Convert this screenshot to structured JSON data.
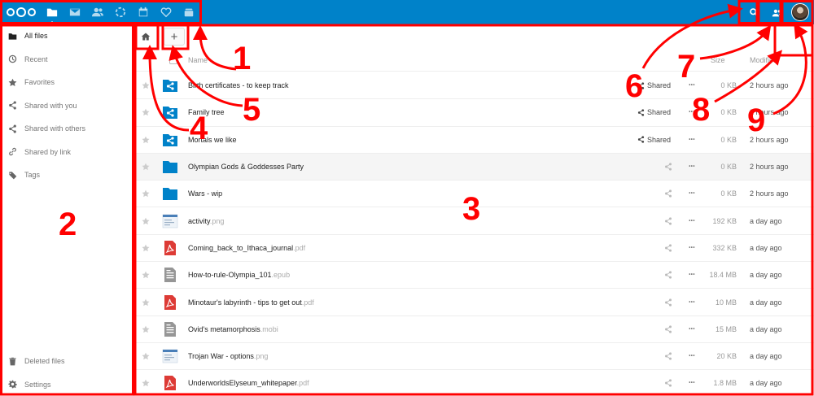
{
  "header": {
    "apps": [
      {
        "name": "files-app-icon",
        "active": true
      },
      {
        "name": "mail-app-icon",
        "active": false
      },
      {
        "name": "contacts-app-icon",
        "active": false
      },
      {
        "name": "activity-app-icon",
        "active": false
      },
      {
        "name": "calendar-app-icon",
        "active": false
      },
      {
        "name": "health-app-icon",
        "active": false
      },
      {
        "name": "deck-app-icon",
        "active": false
      }
    ]
  },
  "sidebar": {
    "items": [
      {
        "label": "All files",
        "icon": "folder-icon"
      },
      {
        "label": "Recent",
        "icon": "clock-icon"
      },
      {
        "label": "Favorites",
        "icon": "star-icon"
      },
      {
        "label": "Shared with you",
        "icon": "share-icon"
      },
      {
        "label": "Shared with others",
        "icon": "share-icon"
      },
      {
        "label": "Shared by link",
        "icon": "link-icon"
      },
      {
        "label": "Tags",
        "icon": "tag-icon"
      }
    ],
    "bottom": [
      {
        "label": "Deleted files",
        "icon": "trash-icon"
      },
      {
        "label": "Settings",
        "icon": "gear-icon"
      }
    ]
  },
  "controls": {
    "add_label": "+"
  },
  "table": {
    "col_name": "Name",
    "col_size": "Size",
    "col_modified": "Modified",
    "rows": [
      {
        "name": "Birth certificates - to keep track",
        "ext": "",
        "type": "shared-folder",
        "shared_label": "Shared",
        "size": "0 KB",
        "modified": "2 hours ago"
      },
      {
        "name": "Family tree",
        "ext": "",
        "type": "shared-folder",
        "shared_label": "Shared",
        "size": "0 KB",
        "modified": "2 hours ago"
      },
      {
        "name": "Mortals we like",
        "ext": "",
        "type": "shared-folder",
        "shared_label": "Shared",
        "size": "0 KB",
        "modified": "2 hours ago"
      },
      {
        "name": "Olympian Gods & Goddesses Party",
        "ext": "",
        "type": "folder",
        "shared_label": "",
        "size": "0 KB",
        "modified": "2 hours ago"
      },
      {
        "name": "Wars - wip",
        "ext": "",
        "type": "folder",
        "shared_label": "",
        "size": "0 KB",
        "modified": "2 hours ago"
      },
      {
        "name": "activity",
        "ext": ".png",
        "type": "image",
        "shared_label": "",
        "size": "192 KB",
        "modified": "a day ago"
      },
      {
        "name": "Coming_back_to_Ithaca_journal",
        "ext": ".pdf",
        "type": "pdf",
        "shared_label": "",
        "size": "332 KB",
        "modified": "a day ago"
      },
      {
        "name": "How-to-rule-Olympia_101",
        "ext": ".epub",
        "type": "doc",
        "shared_label": "",
        "size": "18.4 MB",
        "modified": "a day ago"
      },
      {
        "name": "Minotaur's labyrinth - tips to get out",
        "ext": ".pdf",
        "type": "pdf",
        "shared_label": "",
        "size": "10 MB",
        "modified": "a day ago"
      },
      {
        "name": "Ovid's metamorphosis",
        "ext": ".mobi",
        "type": "doc",
        "shared_label": "",
        "size": "15 MB",
        "modified": "a day ago"
      },
      {
        "name": "Trojan War - options",
        "ext": ".png",
        "type": "image",
        "shared_label": "",
        "size": "20 KB",
        "modified": "a day ago"
      },
      {
        "name": "UnderworldsElyseum_whitepaper",
        "ext": ".pdf",
        "type": "pdf",
        "shared_label": "",
        "size": "1.8 MB",
        "modified": "a day ago"
      }
    ]
  },
  "annotations": {
    "n1": "1",
    "n2": "2",
    "n3": "3",
    "n4": "4",
    "n5": "5",
    "n6": "6",
    "n7": "7",
    "n8": "8",
    "n9": "9"
  },
  "colors": {
    "header": "#0082c9",
    "annotation": "#ff0000",
    "folder": "#0082c9",
    "pdf": "#dd3b36"
  }
}
